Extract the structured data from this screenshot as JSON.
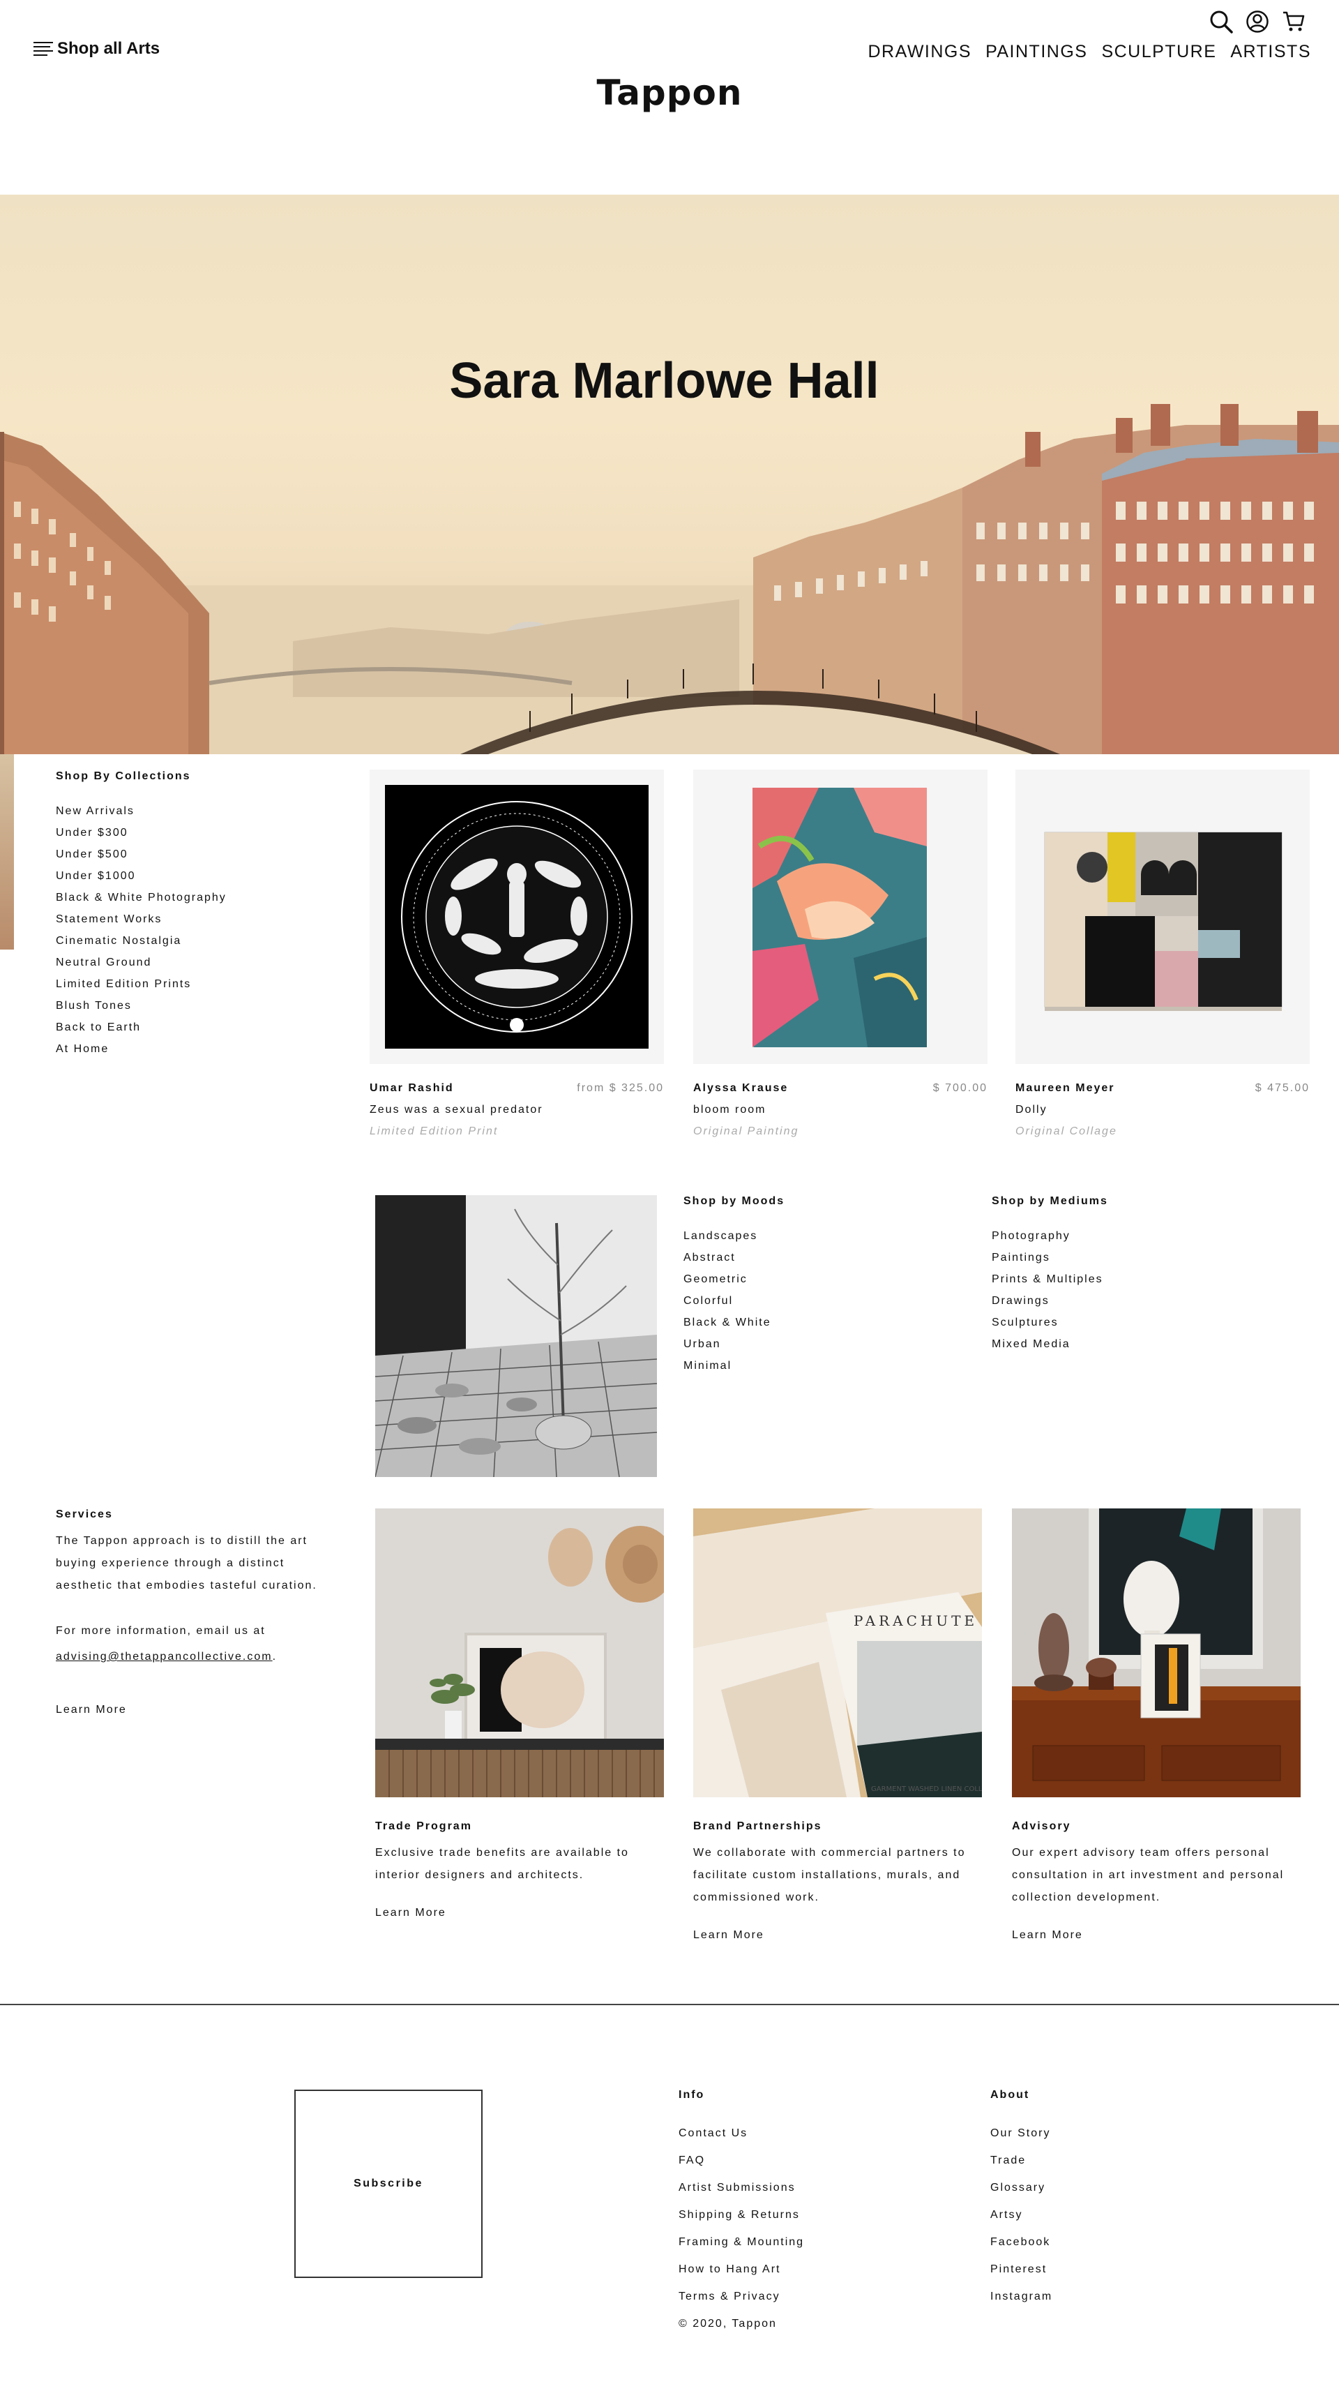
{
  "header": {
    "menu_label": "Shop all Arts",
    "logo": "Tappon",
    "nav": [
      "DRAWINGS",
      "PAINTINGS",
      "SCULPTURE",
      "ARTISTS"
    ]
  },
  "hero": {
    "title": "Sara Marlowe Hall"
  },
  "collections": {
    "heading": "Shop By Collections",
    "items": [
      "New Arrivals",
      "Under $300",
      "Under $500",
      "Under $1000",
      "Black & White Photography",
      "Statement Works",
      "Cinematic Nostalgia",
      "Neutral Ground",
      "Limited Edition Prints",
      "Blush Tones",
      "Back to Earth",
      "At Home"
    ]
  },
  "products": [
    {
      "artist": "Umar Rashid",
      "price": "from $ 325.00",
      "title": "Zeus was a sexual predator",
      "type": "Limited Edition Print"
    },
    {
      "artist": "Alyssa Krause",
      "price": "$ 700.00",
      "title": "bloom room",
      "type": "Original Painting"
    },
    {
      "artist": "Maureen Meyer",
      "price": "$ 475.00",
      "title": "Dolly",
      "type": "Original Collage"
    }
  ],
  "moods": {
    "heading": "Shop by Moods",
    "items": [
      "Landscapes",
      "Abstract",
      "Geometric",
      "Colorful",
      "Black & White",
      "Urban",
      "Minimal"
    ]
  },
  "mediums": {
    "heading": "Shop by Mediums",
    "items": [
      "Photography",
      "Paintings",
      "Prints & Multiples",
      "Drawings",
      "Sculptures",
      "Mixed Media"
    ]
  },
  "services": {
    "heading": "Services",
    "lines": [
      "The Tappon approach is to distill the art",
      "buying experience through a distinct",
      "aesthetic that embodies tasteful curation."
    ],
    "email_intro": "For more information, email us at",
    "email": "advising@thetappancollective.com",
    "email_suffix": ".",
    "learn_more": "Learn More"
  },
  "programs": [
    {
      "title": "Trade Program",
      "lines": [
        "Exclusive trade benefits are available to",
        "interior designers and architects."
      ],
      "learn_more": "Learn More"
    },
    {
      "title": "Brand Partnerships",
      "lines": [
        "We collaborate with commercial partners to",
        "facilitate custom installations, murals, and",
        "commissioned work."
      ],
      "learn_more": "Learn More"
    },
    {
      "title": "Advisory",
      "lines": [
        "Our expert advisory team offers personal",
        "consultation in art investment and personal",
        "collection development."
      ],
      "learn_more": "Learn More"
    }
  ],
  "footer": {
    "subscribe": "Subscribe",
    "info": {
      "heading": "Info",
      "items": [
        "Contact Us",
        "FAQ",
        "Artist Submissions",
        "Shipping & Returns",
        "Framing & Mounting",
        "How to Hang Art",
        "Terms & Privacy",
        "© 2020, Tappon"
      ]
    },
    "about": {
      "heading": "About",
      "items": [
        "Our Story",
        "Trade",
        "Glossary",
        "Artsy",
        "Facebook",
        "Pinterest",
        "Instagram"
      ]
    }
  }
}
